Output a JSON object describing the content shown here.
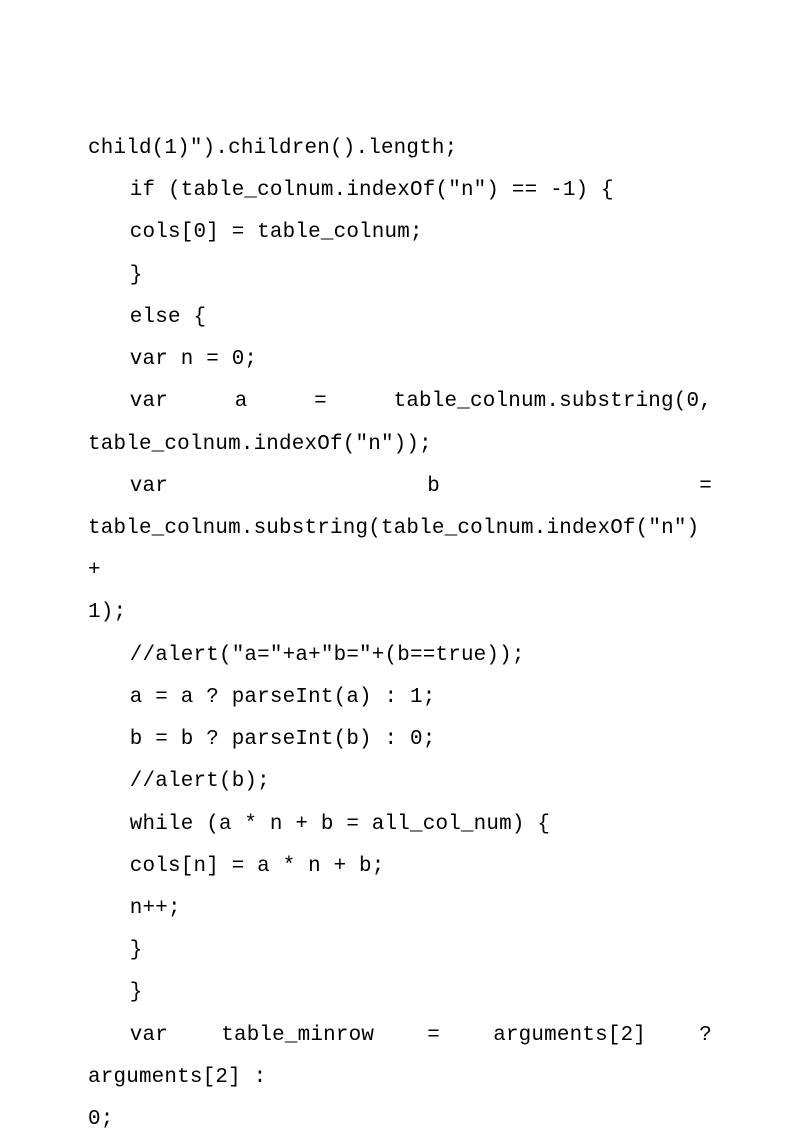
{
  "lines": [
    {
      "cls": "code-line",
      "text": "child(1)\").children().length;"
    },
    {
      "cls": "code-line indent",
      "text": "if (table_colnum.indexOf(\"n\") == -1) {"
    },
    {
      "cls": "code-line indent",
      "text": "cols[0] = table_colnum;"
    },
    {
      "cls": "code-line indent",
      "text": "}"
    },
    {
      "cls": "code-line indent",
      "text": "else {"
    },
    {
      "cls": "code-line indent",
      "text": "var n = 0;"
    },
    {
      "cls": "code-line indent justify-spread",
      "text": "var a = table_colnum.substring(0,"
    },
    {
      "cls": "code-line",
      "text": "table_colnum.indexOf(\"n\"));"
    },
    {
      "cls": "code-line indent justify-spread",
      "text": "var b ="
    },
    {
      "cls": "code-line justify-spread",
      "text": "table_colnum.substring(table_colnum.indexOf(\"n\") +"
    },
    {
      "cls": "code-line",
      "text": "1);"
    },
    {
      "cls": "code-line indent",
      "text": "//alert(\"a=\"+a+\"b=\"+(b==true));"
    },
    {
      "cls": "code-line indent",
      "text": "a = a ? parseInt(a) : 1;"
    },
    {
      "cls": "code-line indent",
      "text": "b = b ? parseInt(b) : 0;"
    },
    {
      "cls": "code-line indent",
      "text": "//alert(b);"
    },
    {
      "cls": "code-line indent",
      "text": "while (a * n + b = all_col_num) {"
    },
    {
      "cls": "code-line indent",
      "text": "cols[n] = a * n + b;"
    },
    {
      "cls": "code-line indent",
      "text": "n++;"
    },
    {
      "cls": "code-line indent",
      "text": "}"
    },
    {
      "cls": "code-line indent",
      "text": "}"
    },
    {
      "cls": "code-line indent",
      "text": "var table_minrow = arguments[2] ? arguments[2] :"
    },
    {
      "cls": "code-line",
      "text": "0;"
    }
  ]
}
